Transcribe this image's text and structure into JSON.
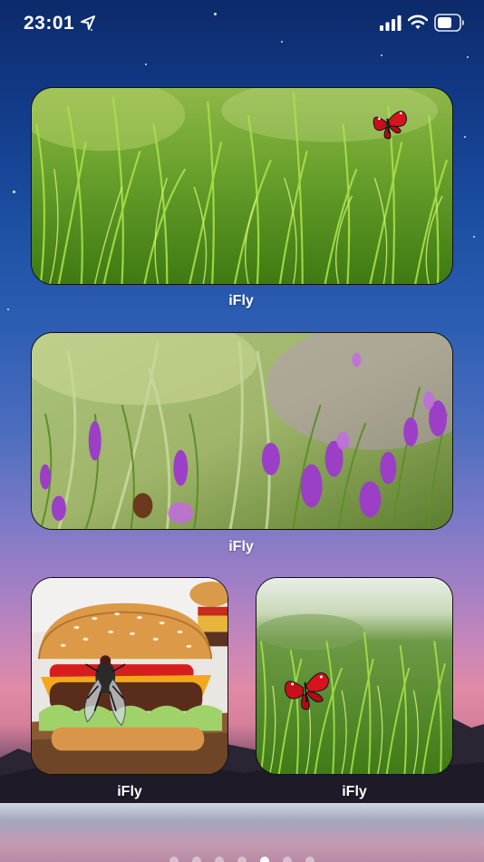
{
  "status_bar": {
    "time": "23:01",
    "icons": [
      "location-arrow-icon",
      "cellular-signal-icon",
      "wifi-icon",
      "battery-icon"
    ]
  },
  "widgets": [
    {
      "label": "iFly",
      "image": "grass-with-red-butterfly",
      "size": "medium"
    },
    {
      "label": "iFly",
      "image": "grass-with-purple-flowers",
      "size": "medium"
    },
    {
      "label": "iFly",
      "image": "burger-with-fly",
      "size": "small"
    },
    {
      "label": "iFly",
      "image": "grass-with-red-butterfly",
      "size": "small"
    }
  ],
  "page_indicator": {
    "total": 7,
    "active_index": 4
  },
  "colors": {
    "wallpaper_top": "#0c2a6a",
    "wallpaper_mid": "#7a79c7",
    "wallpaper_sunset": "#e08aa6",
    "widget_border": "#111111",
    "label_text": "#ffffff"
  }
}
